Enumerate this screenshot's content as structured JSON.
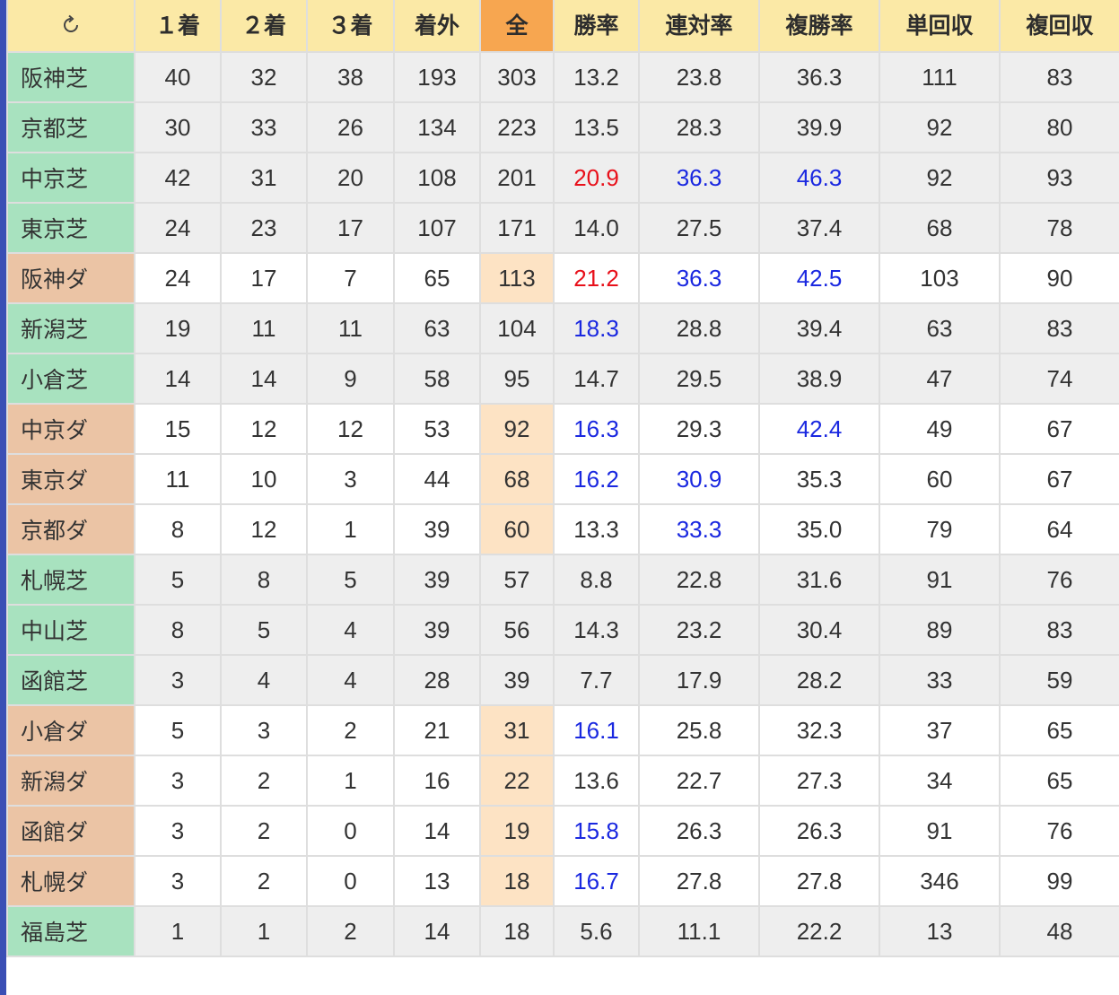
{
  "table": {
    "headers": {
      "refresh_icon": "refresh-icon",
      "first": "１着",
      "second": "２着",
      "third": "３着",
      "out": "着外",
      "total": "全",
      "win_rate": "勝率",
      "quinella_rate": "連対率",
      "show_rate": "複勝率",
      "win_return": "単回収",
      "show_return": "複回収"
    },
    "rows": [
      {
        "venue": "阪神芝",
        "surface": "turf",
        "first": "40",
        "second": "32",
        "third": "38",
        "out": "193",
        "total": "303",
        "win_rate": "13.2",
        "quinella_rate": "23.8",
        "show_rate": "36.3",
        "win_return": "111",
        "show_return": "83"
      },
      {
        "venue": "京都芝",
        "surface": "turf",
        "first": "30",
        "second": "33",
        "third": "26",
        "out": "134",
        "total": "223",
        "win_rate": "13.5",
        "quinella_rate": "28.3",
        "show_rate": "39.9",
        "win_return": "92",
        "show_return": "80"
      },
      {
        "venue": "中京芝",
        "surface": "turf",
        "first": "42",
        "second": "31",
        "third": "20",
        "out": "108",
        "total": "201",
        "win_rate": "20.9",
        "quinella_rate": "36.3",
        "show_rate": "46.3",
        "win_return": "92",
        "show_return": "93"
      },
      {
        "venue": "東京芝",
        "surface": "turf",
        "first": "24",
        "second": "23",
        "third": "17",
        "out": "107",
        "total": "171",
        "win_rate": "14.0",
        "quinella_rate": "27.5",
        "show_rate": "37.4",
        "win_return": "68",
        "show_return": "78"
      },
      {
        "venue": "阪神ダ",
        "surface": "dirt",
        "first": "24",
        "second": "17",
        "third": "7",
        "out": "65",
        "total": "113",
        "win_rate": "21.2",
        "quinella_rate": "36.3",
        "show_rate": "42.5",
        "win_return": "103",
        "show_return": "90"
      },
      {
        "venue": "新潟芝",
        "surface": "turf",
        "first": "19",
        "second": "11",
        "third": "11",
        "out": "63",
        "total": "104",
        "win_rate": "18.3",
        "quinella_rate": "28.8",
        "show_rate": "39.4",
        "win_return": "63",
        "show_return": "83"
      },
      {
        "venue": "小倉芝",
        "surface": "turf",
        "first": "14",
        "second": "14",
        "third": "9",
        "out": "58",
        "total": "95",
        "win_rate": "14.7",
        "quinella_rate": "29.5",
        "show_rate": "38.9",
        "win_return": "47",
        "show_return": "74"
      },
      {
        "venue": "中京ダ",
        "surface": "dirt",
        "first": "15",
        "second": "12",
        "third": "12",
        "out": "53",
        "total": "92",
        "win_rate": "16.3",
        "quinella_rate": "29.3",
        "show_rate": "42.4",
        "win_return": "49",
        "show_return": "67"
      },
      {
        "venue": "東京ダ",
        "surface": "dirt",
        "first": "11",
        "second": "10",
        "third": "3",
        "out": "44",
        "total": "68",
        "win_rate": "16.2",
        "quinella_rate": "30.9",
        "show_rate": "35.3",
        "win_return": "60",
        "show_return": "67"
      },
      {
        "venue": "京都ダ",
        "surface": "dirt",
        "first": "8",
        "second": "12",
        "third": "1",
        "out": "39",
        "total": "60",
        "win_rate": "13.3",
        "quinella_rate": "33.3",
        "show_rate": "35.0",
        "win_return": "79",
        "show_return": "64"
      },
      {
        "venue": "札幌芝",
        "surface": "turf",
        "first": "5",
        "second": "8",
        "third": "5",
        "out": "39",
        "total": "57",
        "win_rate": "8.8",
        "quinella_rate": "22.8",
        "show_rate": "31.6",
        "win_return": "91",
        "show_return": "76"
      },
      {
        "venue": "中山芝",
        "surface": "turf",
        "first": "8",
        "second": "5",
        "third": "4",
        "out": "39",
        "total": "56",
        "win_rate": "14.3",
        "quinella_rate": "23.2",
        "show_rate": "30.4",
        "win_return": "89",
        "show_return": "83"
      },
      {
        "venue": "函館芝",
        "surface": "turf",
        "first": "3",
        "second": "4",
        "third": "4",
        "out": "28",
        "total": "39",
        "win_rate": "7.7",
        "quinella_rate": "17.9",
        "show_rate": "28.2",
        "win_return": "33",
        "show_return": "59"
      },
      {
        "venue": "小倉ダ",
        "surface": "dirt",
        "first": "5",
        "second": "3",
        "third": "2",
        "out": "21",
        "total": "31",
        "win_rate": "16.1",
        "quinella_rate": "25.8",
        "show_rate": "32.3",
        "win_return": "37",
        "show_return": "65"
      },
      {
        "venue": "新潟ダ",
        "surface": "dirt",
        "first": "3",
        "second": "2",
        "third": "1",
        "out": "16",
        "total": "22",
        "win_rate": "13.6",
        "quinella_rate": "22.7",
        "show_rate": "27.3",
        "win_return": "34",
        "show_return": "65"
      },
      {
        "venue": "函館ダ",
        "surface": "dirt",
        "first": "3",
        "second": "2",
        "third": "0",
        "out": "14",
        "total": "19",
        "win_rate": "15.8",
        "quinella_rate": "26.3",
        "show_rate": "26.3",
        "win_return": "91",
        "show_return": "76"
      },
      {
        "venue": "札幌ダ",
        "surface": "dirt",
        "first": "3",
        "second": "2",
        "third": "0",
        "out": "13",
        "total": "18",
        "win_rate": "16.7",
        "quinella_rate": "27.8",
        "show_rate": "27.8",
        "win_return": "346",
        "show_return": "99"
      },
      {
        "venue": "福島芝",
        "surface": "turf",
        "first": "1",
        "second": "1",
        "third": "2",
        "out": "14",
        "total": "18",
        "win_rate": "5.6",
        "quinella_rate": "11.1",
        "show_rate": "22.2",
        "win_return": "13",
        "show_return": "48"
      }
    ],
    "highlight": {
      "win_rate_red_min": 20,
      "win_rate_blue_min": 15,
      "quinella_rate_blue_min": 30,
      "show_rate_blue_min": 40
    }
  },
  "colors": {
    "header_bg": "#fbe9a6",
    "header_active_bg": "#f7a650",
    "turf_label_bg": "#a8e2bf",
    "dirt_label_bg": "#ebc4a5",
    "dirt_total_bg": "#fde3c4",
    "turf_row_bg": "#eeeeee",
    "dirt_row_bg": "#ffffff",
    "highlight_red": "#e8101a",
    "highlight_blue": "#1a28e0",
    "left_accent": "#3a4fb5"
  }
}
